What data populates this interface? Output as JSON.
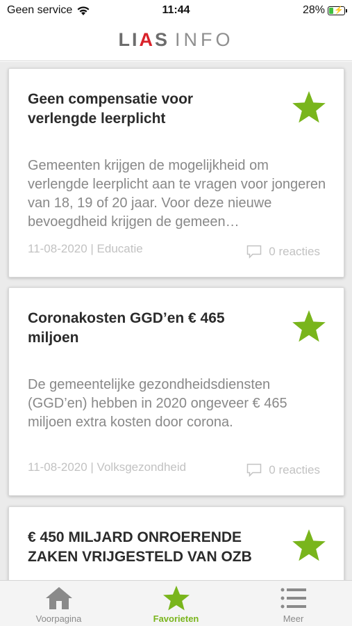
{
  "status_bar": {
    "carrier": "Geen service",
    "time": "11:44",
    "battery_percent": "28%",
    "battery_level": 0.28,
    "wifi_icon": "wifi-icon",
    "battery_icon": "battery-charging-icon"
  },
  "header": {
    "logo_brand": "LIAS",
    "logo_suffix": "INFO"
  },
  "colors": {
    "accent_green": "#79b51c",
    "logo_red": "#d9222a"
  },
  "articles": [
    {
      "title": "Geen compensatie voor verlengde leerplicht",
      "excerpt": "Gemeenten krijgen de mogelijkheid om verlengde leerplicht aan te vragen voor jongeren van 18, 19 of 20 jaar. Voor deze nieuwe bevoegdheid krijgen de gemeen…",
      "meta": "11-08-2020 | Educatie",
      "reacties": "0 reacties",
      "favorite": true
    },
    {
      "title": "Coronakosten GGD’en € 465 miljoen",
      "excerpt": "De gemeentelijke gezondheidsdiensten (GGD’en) hebben in 2020 ongeveer € 465 miljoen extra kosten door corona.",
      "meta": "11-08-2020 | Volksgezondheid",
      "reacties": "0 reacties",
      "favorite": true
    },
    {
      "title": "€ 450 MILJARD ONROERENDE ZAKEN VRIJGESTELD VAN OZB",
      "favorite": true
    }
  ],
  "tabs": [
    {
      "label": "Voorpagina",
      "icon": "home-icon",
      "active": false
    },
    {
      "label": "Favorieten",
      "icon": "star-icon",
      "active": true
    },
    {
      "label": "Meer",
      "icon": "menu-icon",
      "active": false
    }
  ]
}
